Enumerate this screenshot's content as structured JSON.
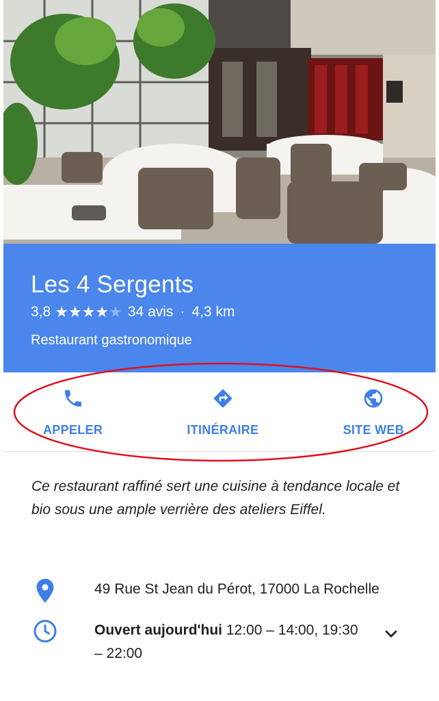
{
  "place": {
    "name": "Les 4 Sergents",
    "rating": "3,8",
    "stars_filled": 4,
    "stars_total": 5,
    "reviews": "34 avis",
    "separator": "·",
    "distance": "4,3 km",
    "category": "Restaurant gastronomique"
  },
  "actions": {
    "call_label": "APPELER",
    "directions_label": "ITINÉRAIRE",
    "website_label": "SITE WEB"
  },
  "description": "Ce restaurant raffiné sert une cuisine à tendance locale et bio sous une ample verrière des ateliers Eiffel.",
  "details": {
    "address": "49 Rue St Jean du Pérot, 17000 La Rochelle",
    "hours_status": "Ouvert aujourd'hui",
    "hours_times": "12:00 – 14:00, 19:30 – 22:00"
  },
  "colors": {
    "banner": "#4a86ec",
    "accent": "#3d7fe6",
    "highlight": "#e0101d"
  },
  "icons": {
    "call": "phone-icon",
    "directions": "directions-icon",
    "website": "globe-icon",
    "address": "location-pin-icon",
    "hours": "clock-icon",
    "expand": "chevron-down-icon"
  }
}
